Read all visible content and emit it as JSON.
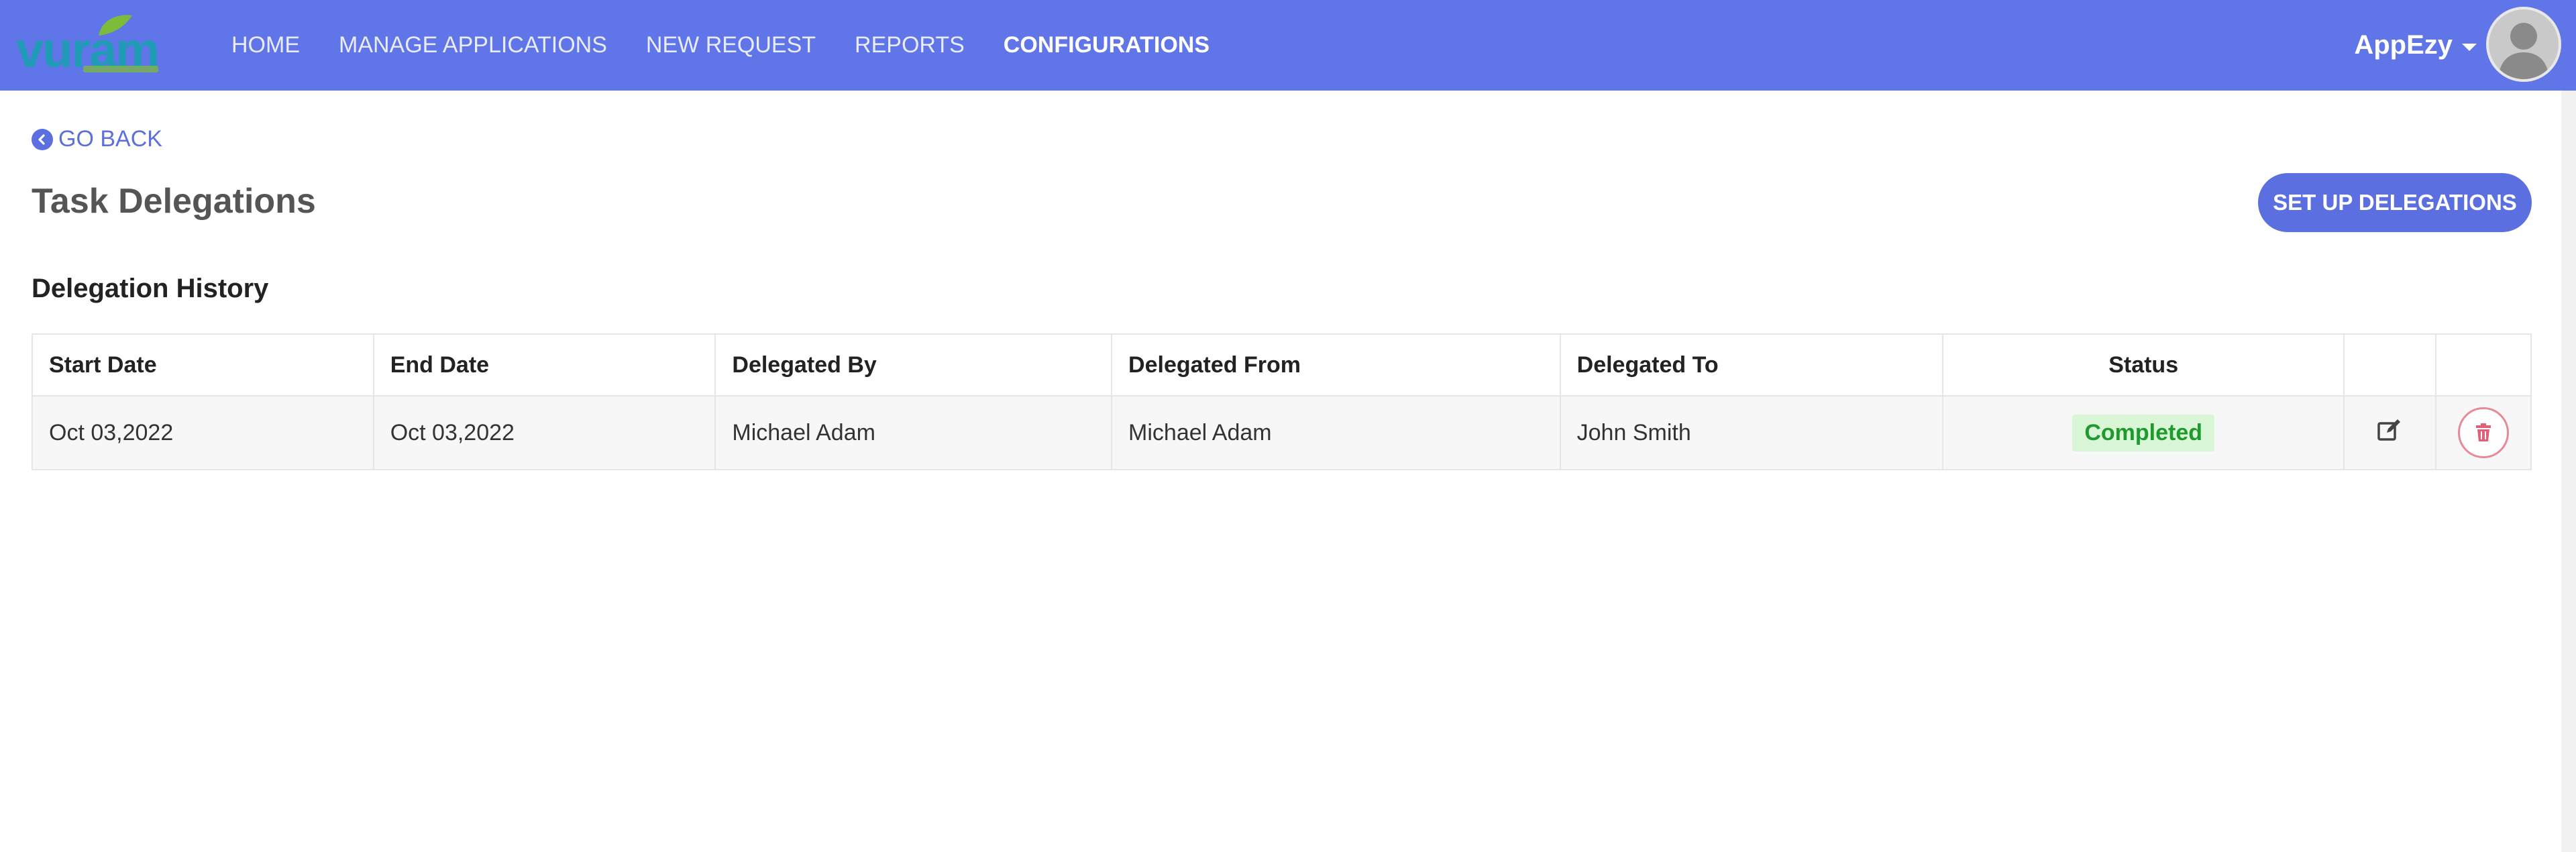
{
  "nav": {
    "logo_text": "vuram",
    "links": [
      "HOME",
      "MANAGE APPLICATIONS",
      "NEW REQUEST",
      "REPORTS",
      "CONFIGURATIONS"
    ],
    "active": "CONFIGURATIONS",
    "user": "AppEzy"
  },
  "page": {
    "back_label": "GO BACK",
    "title": "Task Delegations",
    "setup_label": "SET UP DELEGATIONS",
    "section_title": "Delegation History"
  },
  "table": {
    "headers": [
      "Start Date",
      "End Date",
      "Delegated By",
      "Delegated From",
      "Delegated To",
      "Status"
    ],
    "rows": [
      {
        "start_date": "Oct 03,2022",
        "end_date": "Oct 03,2022",
        "delegated_by": "Michael Adam",
        "delegated_from": "Michael Adam",
        "delegated_to": "John Smith",
        "status": "Completed"
      }
    ]
  },
  "colors": {
    "navbar": "#6075e8",
    "accent": "#5c6fe0",
    "status_completed_bg": "#d9f7d6",
    "status_completed_text": "#1e9a2e",
    "delete": "#e58a96"
  },
  "icons": {
    "back": "chevron-left-circle-icon",
    "edit": "edit-icon",
    "delete": "trash-icon",
    "avatar": "user-avatar-icon",
    "caret": "caret-down-icon"
  }
}
